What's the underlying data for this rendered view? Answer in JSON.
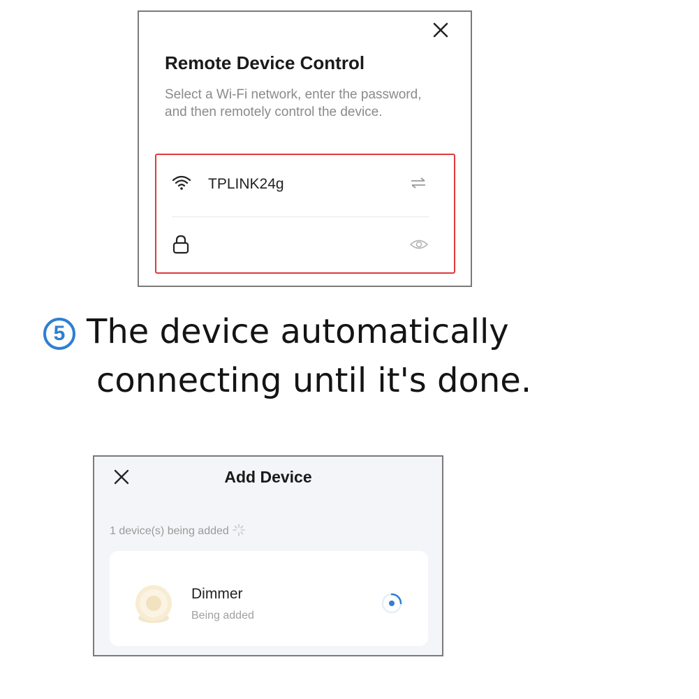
{
  "remote_dialog": {
    "title": "Remote Device Control",
    "description": "Select a Wi-Fi network, enter the password, and then remotely control the device.",
    "ssid": "TPLINK24g",
    "password_value": "",
    "icons": {
      "close": "close-icon",
      "wifi": "wifi-icon",
      "switch": "switch-network-icon",
      "lock": "lock-icon",
      "eye": "eye-icon"
    },
    "highlight_color": "#e0393b"
  },
  "step": {
    "number": "5",
    "line1": "The device automatically",
    "line2": "connecting until it's done.",
    "accent_color": "#2f7fd1"
  },
  "add_device": {
    "title": "Add Device",
    "status_text": "1 device(s) being added",
    "device": {
      "name": "Dimmer",
      "status": "Being added"
    },
    "spinner_color": "#2f7fd1"
  }
}
